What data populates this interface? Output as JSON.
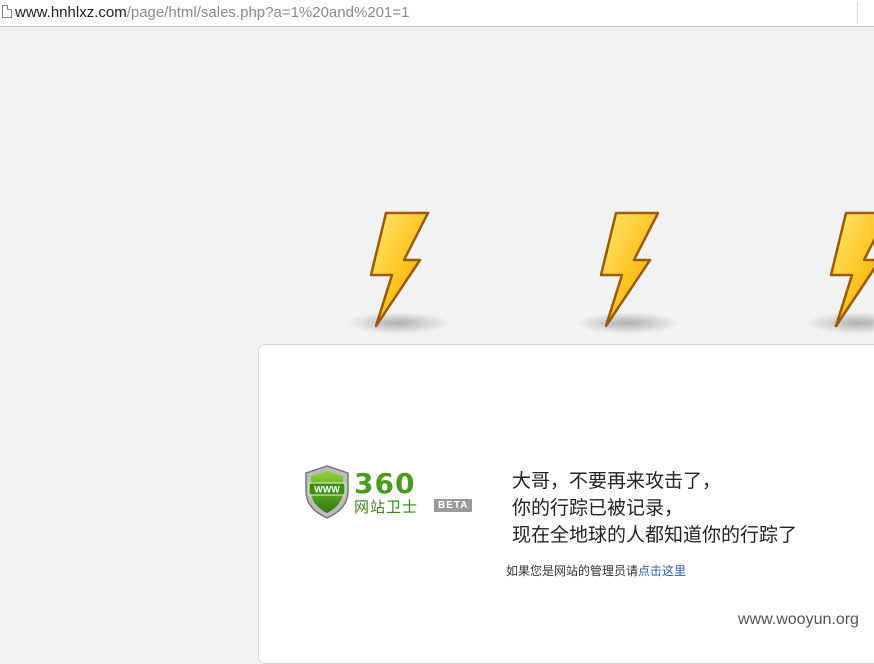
{
  "browser": {
    "url_host": "www.hnhlxz.com",
    "url_path": "/page/html/sales.php?a=1%20and%201=1"
  },
  "icons": [
    "page-icon",
    "lightning-bolt-icon",
    "shield-www-icon"
  ],
  "colors": {
    "background": "#f2f2f2",
    "card": "#ffffff",
    "bolt_light": "#ffd84a",
    "bolt_dark": "#f08a00",
    "logo_green": "#4d9b1e",
    "link": "#2a5db0"
  },
  "logo": {
    "shield_text": "WWW",
    "digits": "360",
    "brand": "网站卫士",
    "badge": "BETA"
  },
  "message": {
    "line1": "大哥，不要再来攻击了，",
    "line2": "你的行踪已被记录，",
    "line3": "现在全地球的人都知道你的行踪了"
  },
  "admin_note": {
    "prefix": "如果您是网站的管理员请",
    "link": "点击这里"
  },
  "watermark": "www.wooyun.org"
}
